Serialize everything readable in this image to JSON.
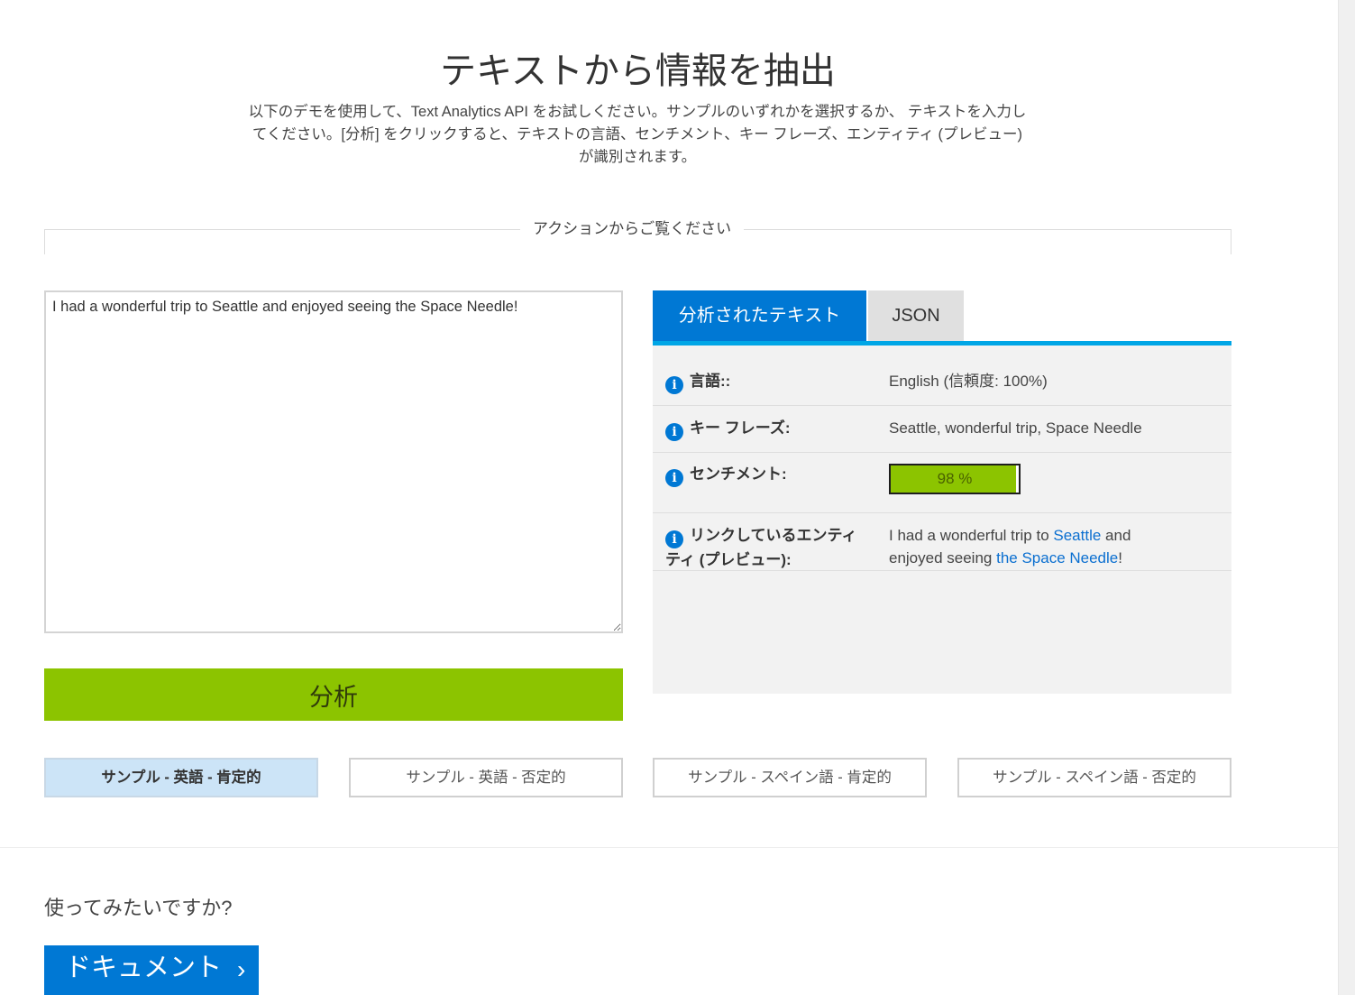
{
  "header": {
    "title": "テキストから情報を抽出",
    "description": "以下のデモを使用して、Text Analytics API をお試しください。サンプルのいずれかを選択するか、 テキストを入力してください。[分析] をクリックすると、テキストの言語、センチメント、キー フレーズ、エンティティ (プレビュー) が識別されます。"
  },
  "section": {
    "label": "アクションからご覧ください"
  },
  "input": {
    "value": "I had a wonderful trip to Seattle and enjoyed seeing the Space Needle!"
  },
  "analyze": {
    "label": "分析"
  },
  "tabs": [
    {
      "label": "分析されたテキスト",
      "active": true
    },
    {
      "label": "JSON",
      "active": false
    }
  ],
  "results": {
    "language": {
      "label": "言語::",
      "value": "English (信頼度: 100%)"
    },
    "key_phrases": {
      "label": "キー フレーズ:",
      "value": "Seattle, wonderful trip, Space Needle"
    },
    "sentiment": {
      "label": "センチメント:",
      "value_text": "98 %",
      "score": 0.98
    },
    "entities": {
      "label": "リンクしているエンティティ (プレビュー):",
      "parts": [
        {
          "text": "I had a wonderful trip to ",
          "link": false
        },
        {
          "text": "Seattle",
          "link": true
        },
        {
          "text": " and enjoyed seeing ",
          "link": false
        },
        {
          "text": "the Space Needle",
          "link": true
        },
        {
          "text": "!",
          "link": false
        }
      ]
    }
  },
  "samples": [
    {
      "label": "サンプル - 英語 - 肯定的",
      "selected": true
    },
    {
      "label": "サンプル - 英語 - 否定的",
      "selected": false
    },
    {
      "label": "サンプル - スペイン語 - 肯定的",
      "selected": false
    },
    {
      "label": "サンプル - スペイン語 - 否定的",
      "selected": false
    }
  ],
  "cta": {
    "question": "使ってみたいですか?",
    "docs_label": "ドキュメント",
    "docs_chevron": "›"
  },
  "colors": {
    "accent_blue": "#0078d4",
    "analyze_green": "#8cc400",
    "tab_underline": "#00a6e6",
    "selected_sample": "#cce4f7",
    "link": "#0b6fd0"
  }
}
